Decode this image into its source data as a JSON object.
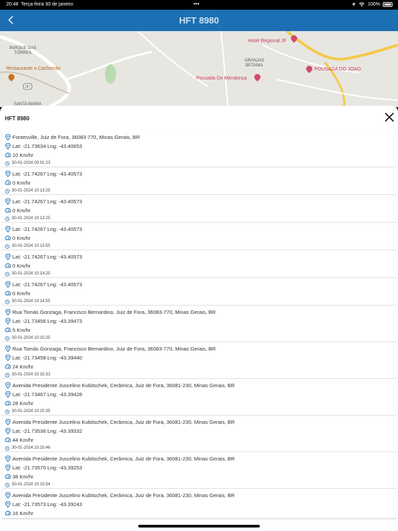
{
  "status_bar": {
    "time": "20:48",
    "date": "Terça-feira 30 de janeiro",
    "dots": "•••",
    "battery": "100%"
  },
  "nav": {
    "title": "HFT 8980",
    "back_icon": "chevron-left-icon"
  },
  "map": {
    "labels": [
      "PARQUE DAS TORRES",
      "GRANJAS BETANIA",
      "SANTA MARIA"
    ],
    "pois": [
      "Restaurante o Cachorrão",
      "Hotel Regional JF",
      "POUSADA DO JOAO",
      "Pousada Do Mendonça"
    ],
    "route_shield": "267"
  },
  "sheet": {
    "title": "HFT 8980",
    "close_icon": "close-icon"
  },
  "records": [
    {
      "address": "Fontesville, Juiz de Fora, 36083-770, Minas Gerais, BR",
      "coords": "Lat: -21.73634 Lng: -43.40653",
      "speed": "10 Km/hr",
      "time": "30-01-2024 00:01:23"
    },
    {
      "address": "",
      "coords": "Lat: -21.74267 Lng: -43.40573",
      "speed": "0 Km/hr",
      "time": "30-01-2024 10:13:25"
    },
    {
      "address": "",
      "coords": "Lat: -21.74267 Lng: -43.40573",
      "speed": "0 Km/hr",
      "time": "30-01-2024 10:13:25"
    },
    {
      "address": "",
      "coords": "Lat: -21.74267 Lng: -43.40573",
      "speed": "0 Km/hr",
      "time": "30-01-2024 10:13:55"
    },
    {
      "address": "",
      "coords": "Lat: -21.74267 Lng: -43.40573",
      "speed": "0 Km/hr",
      "time": "30-01-2024 10:14:25"
    },
    {
      "address": "",
      "coords": "Lat: -21.74267 Lng: -43.40573",
      "speed": "0 Km/hr",
      "time": "30-01-2024 10:14:55"
    },
    {
      "address": "Rua Tomás Gonzaga, Francisco Bernardino, Juiz de Fora, 36083-770, Minas Gerais, BR",
      "coords": "Lat: -21.73456 Lng: -43.39473",
      "speed": "5 Km/hr",
      "time": "30-01-2024 10:15:25"
    },
    {
      "address": "Rua Tomás Gonzaga, Francisco Bernardino, Juiz de Fora, 36083-770, Minas Gerais, BR",
      "coords": "Lat: -21.73458 Lng: -43.39440",
      "speed": "24 Km/hr",
      "time": "30-01-2024 10:15:33"
    },
    {
      "address": "Avenida Presidente Juscelino Kubitschek, Cerâmica, Juiz de Fora, 36081-230, Minas Gerais, BR",
      "coords": "Lat: -21.73467 Lng: -43.39428",
      "speed": "28 Km/hr",
      "time": "30-01-2024 10:15:35"
    },
    {
      "address": "Avenida Presidente Juscelino Kubitschek, Cerâmica, Juiz de Fora, 36081-230, Minas Gerais, BR",
      "coords": "Lat: -21.73536 Lng: -43.39332",
      "speed": "44 Km/hr",
      "time": "30-01-2024 10:15:46"
    },
    {
      "address": "Avenida Presidente Juscelino Kubitschek, Cerâmica, Juiz de Fora, 36081-230, Minas Gerais, BR",
      "coords": "Lat: -21.73570 Lng: -43.39253",
      "speed": "38 Km/hr",
      "time": "30-01-2024 10:15:54"
    },
    {
      "address": "Avenida Presidente Juscelino Kubitschek, Cerâmica, Juiz de Fora, 36081-230, Minas Gerais, BR",
      "coords": "Lat: -21.73573 Lng: -43.39243",
      "speed": "16 Km/hr",
      "time": ""
    }
  ],
  "colors": {
    "nav_bg": "#1d6fb3",
    "icon": "#1d6fb3",
    "poi": "#c73c5b"
  },
  "record_icons": {
    "address": "map-pin-icon",
    "coords": "map-pin-icon",
    "speed": "speedometer-icon",
    "time": "clock-icon"
  }
}
